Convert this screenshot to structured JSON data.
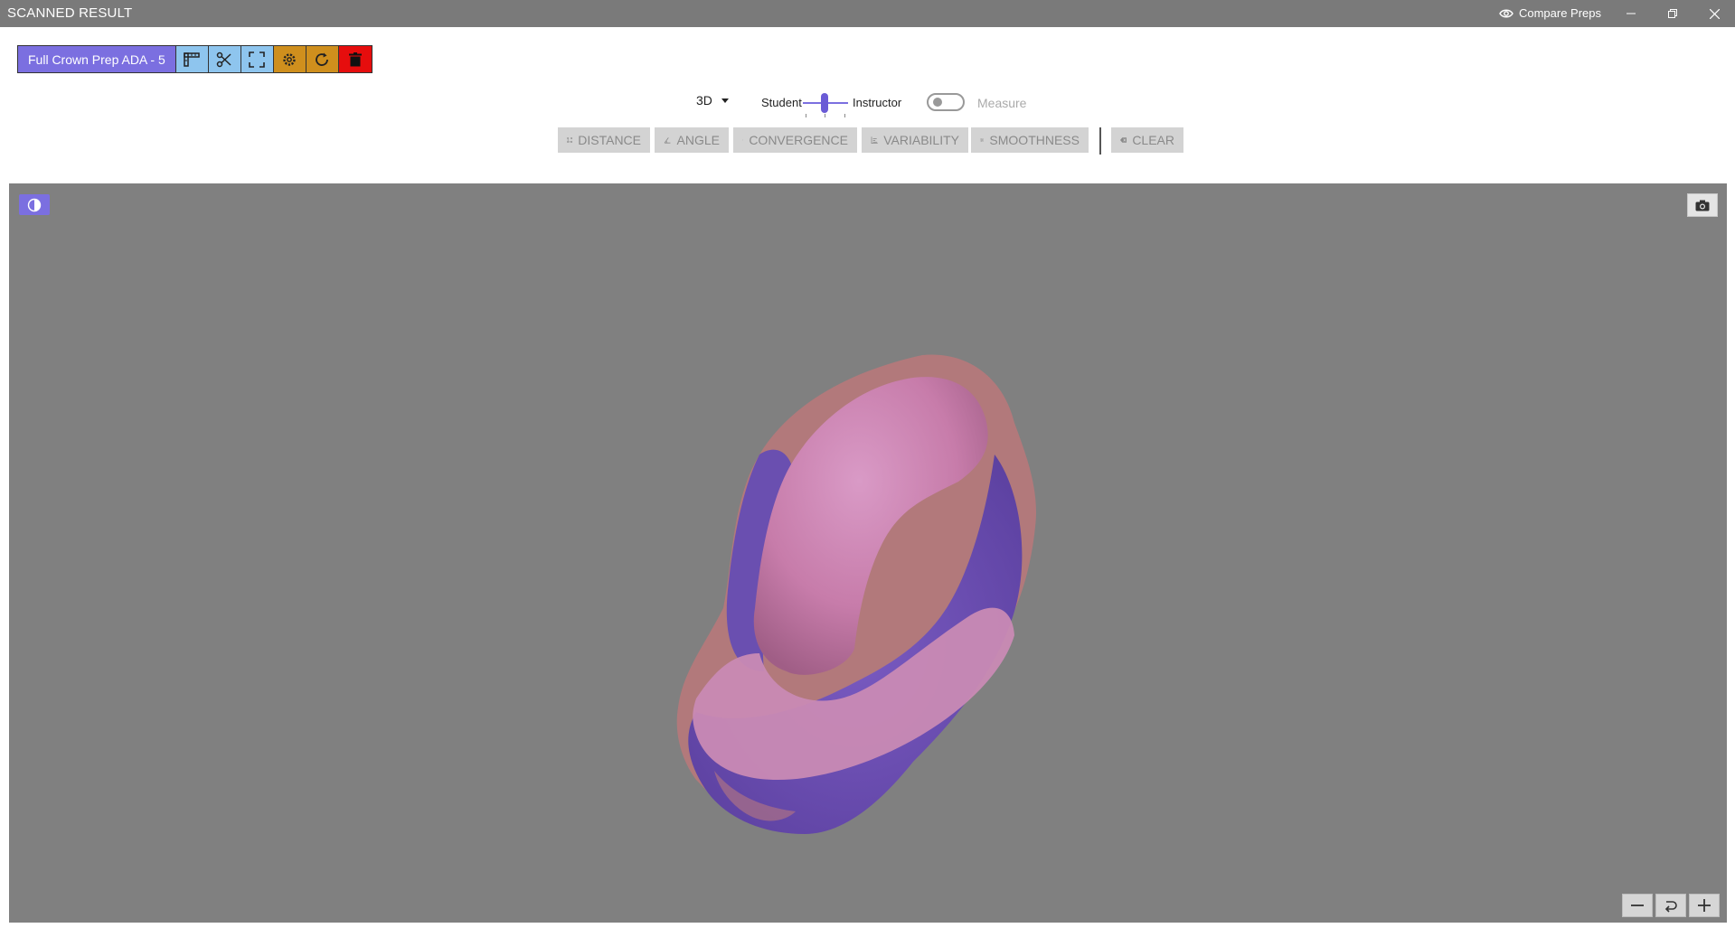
{
  "window": {
    "title": "SCANNED RESULT",
    "compare_label": "Compare Preps"
  },
  "prep_toolbar": {
    "prep_name": "Full Crown Prep ADA - 5",
    "tools": [
      "ruler-icon",
      "scissors-icon",
      "fit-view-icon",
      "settings-icon",
      "refresh-icon",
      "delete-icon"
    ]
  },
  "controls": {
    "view_mode": "3D",
    "student_label": "Student",
    "instructor_label": "Instructor",
    "blend_slider_value": 0.5,
    "measure_label": "Measure",
    "measure_enabled": false
  },
  "measure_tools": {
    "distance": "DISTANCE",
    "angle": "ANGLE",
    "convergence": "CONVERGENCE",
    "variability": "VARIABILITY",
    "smoothness": "SMOOTHNESS",
    "clear": "CLEAR"
  },
  "colors": {
    "accent": "#7b6fe0",
    "viewport_bg": "#808080",
    "student_model": "#c57aaa",
    "instructor_model": "#6a4fb0"
  }
}
